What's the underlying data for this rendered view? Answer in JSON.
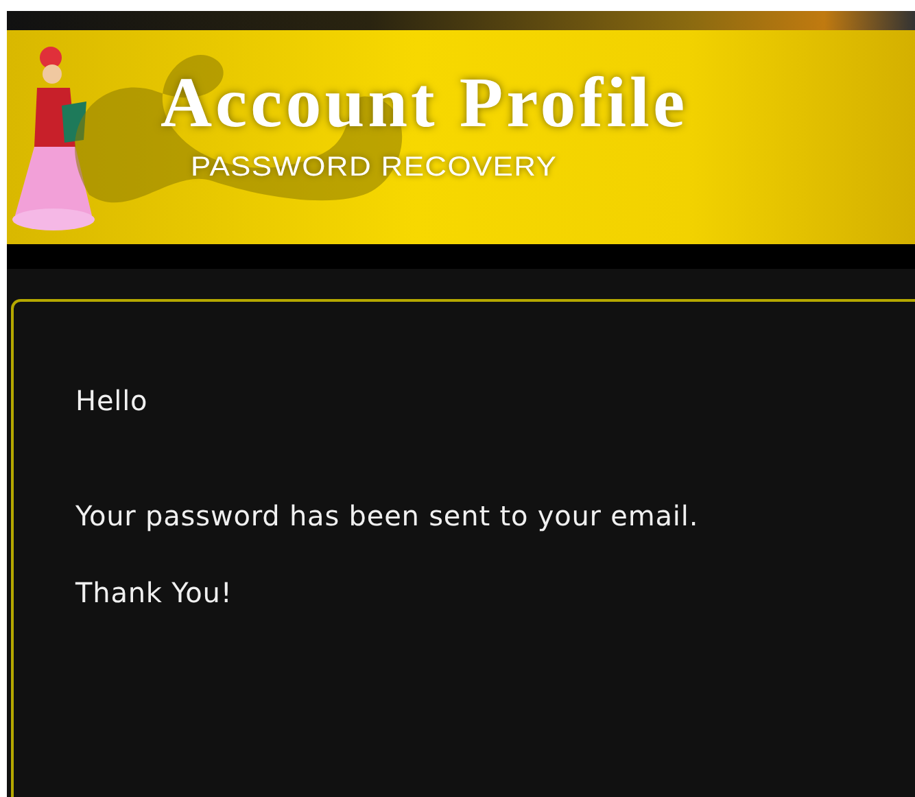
{
  "banner": {
    "title": "Account Profile",
    "subtitle": "PASSWORD RECOVERY"
  },
  "message": {
    "greeting": "Hello",
    "paragraphs": [
      "Your password has been sent to your email.",
      "Thank You!"
    ]
  }
}
